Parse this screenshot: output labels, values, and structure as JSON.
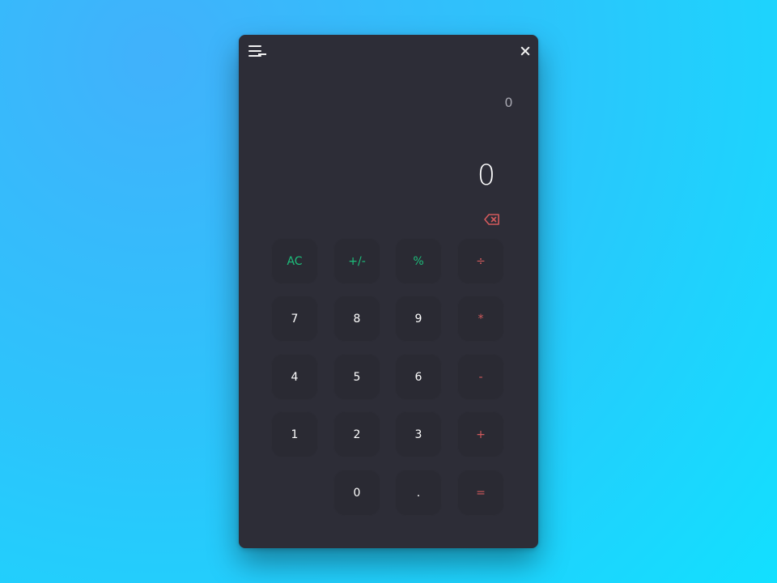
{
  "window": {
    "history": "0",
    "display": "0"
  },
  "icons": {
    "menu": "menu-icon",
    "minimize": "minimize-icon",
    "close": "close-icon",
    "backspace": "backspace-icon"
  },
  "colors": {
    "background_start": "#41b1fb",
    "background_end": "#12e0ff",
    "window": "#2d2d37",
    "key": "#2a2a33",
    "accent": "#1dbf7c",
    "operator": "#d25a5c",
    "text": "#ffffff",
    "history_text": "#a6a6af"
  },
  "keys": {
    "row1": [
      "AC",
      "+/-",
      "%",
      "÷"
    ],
    "row2": [
      "7",
      "8",
      "9",
      "*"
    ],
    "row3": [
      "4",
      "5",
      "6",
      "-"
    ],
    "row4": [
      "1",
      "2",
      "3",
      "+"
    ],
    "row5": [
      "",
      "0",
      ".",
      "="
    ]
  }
}
